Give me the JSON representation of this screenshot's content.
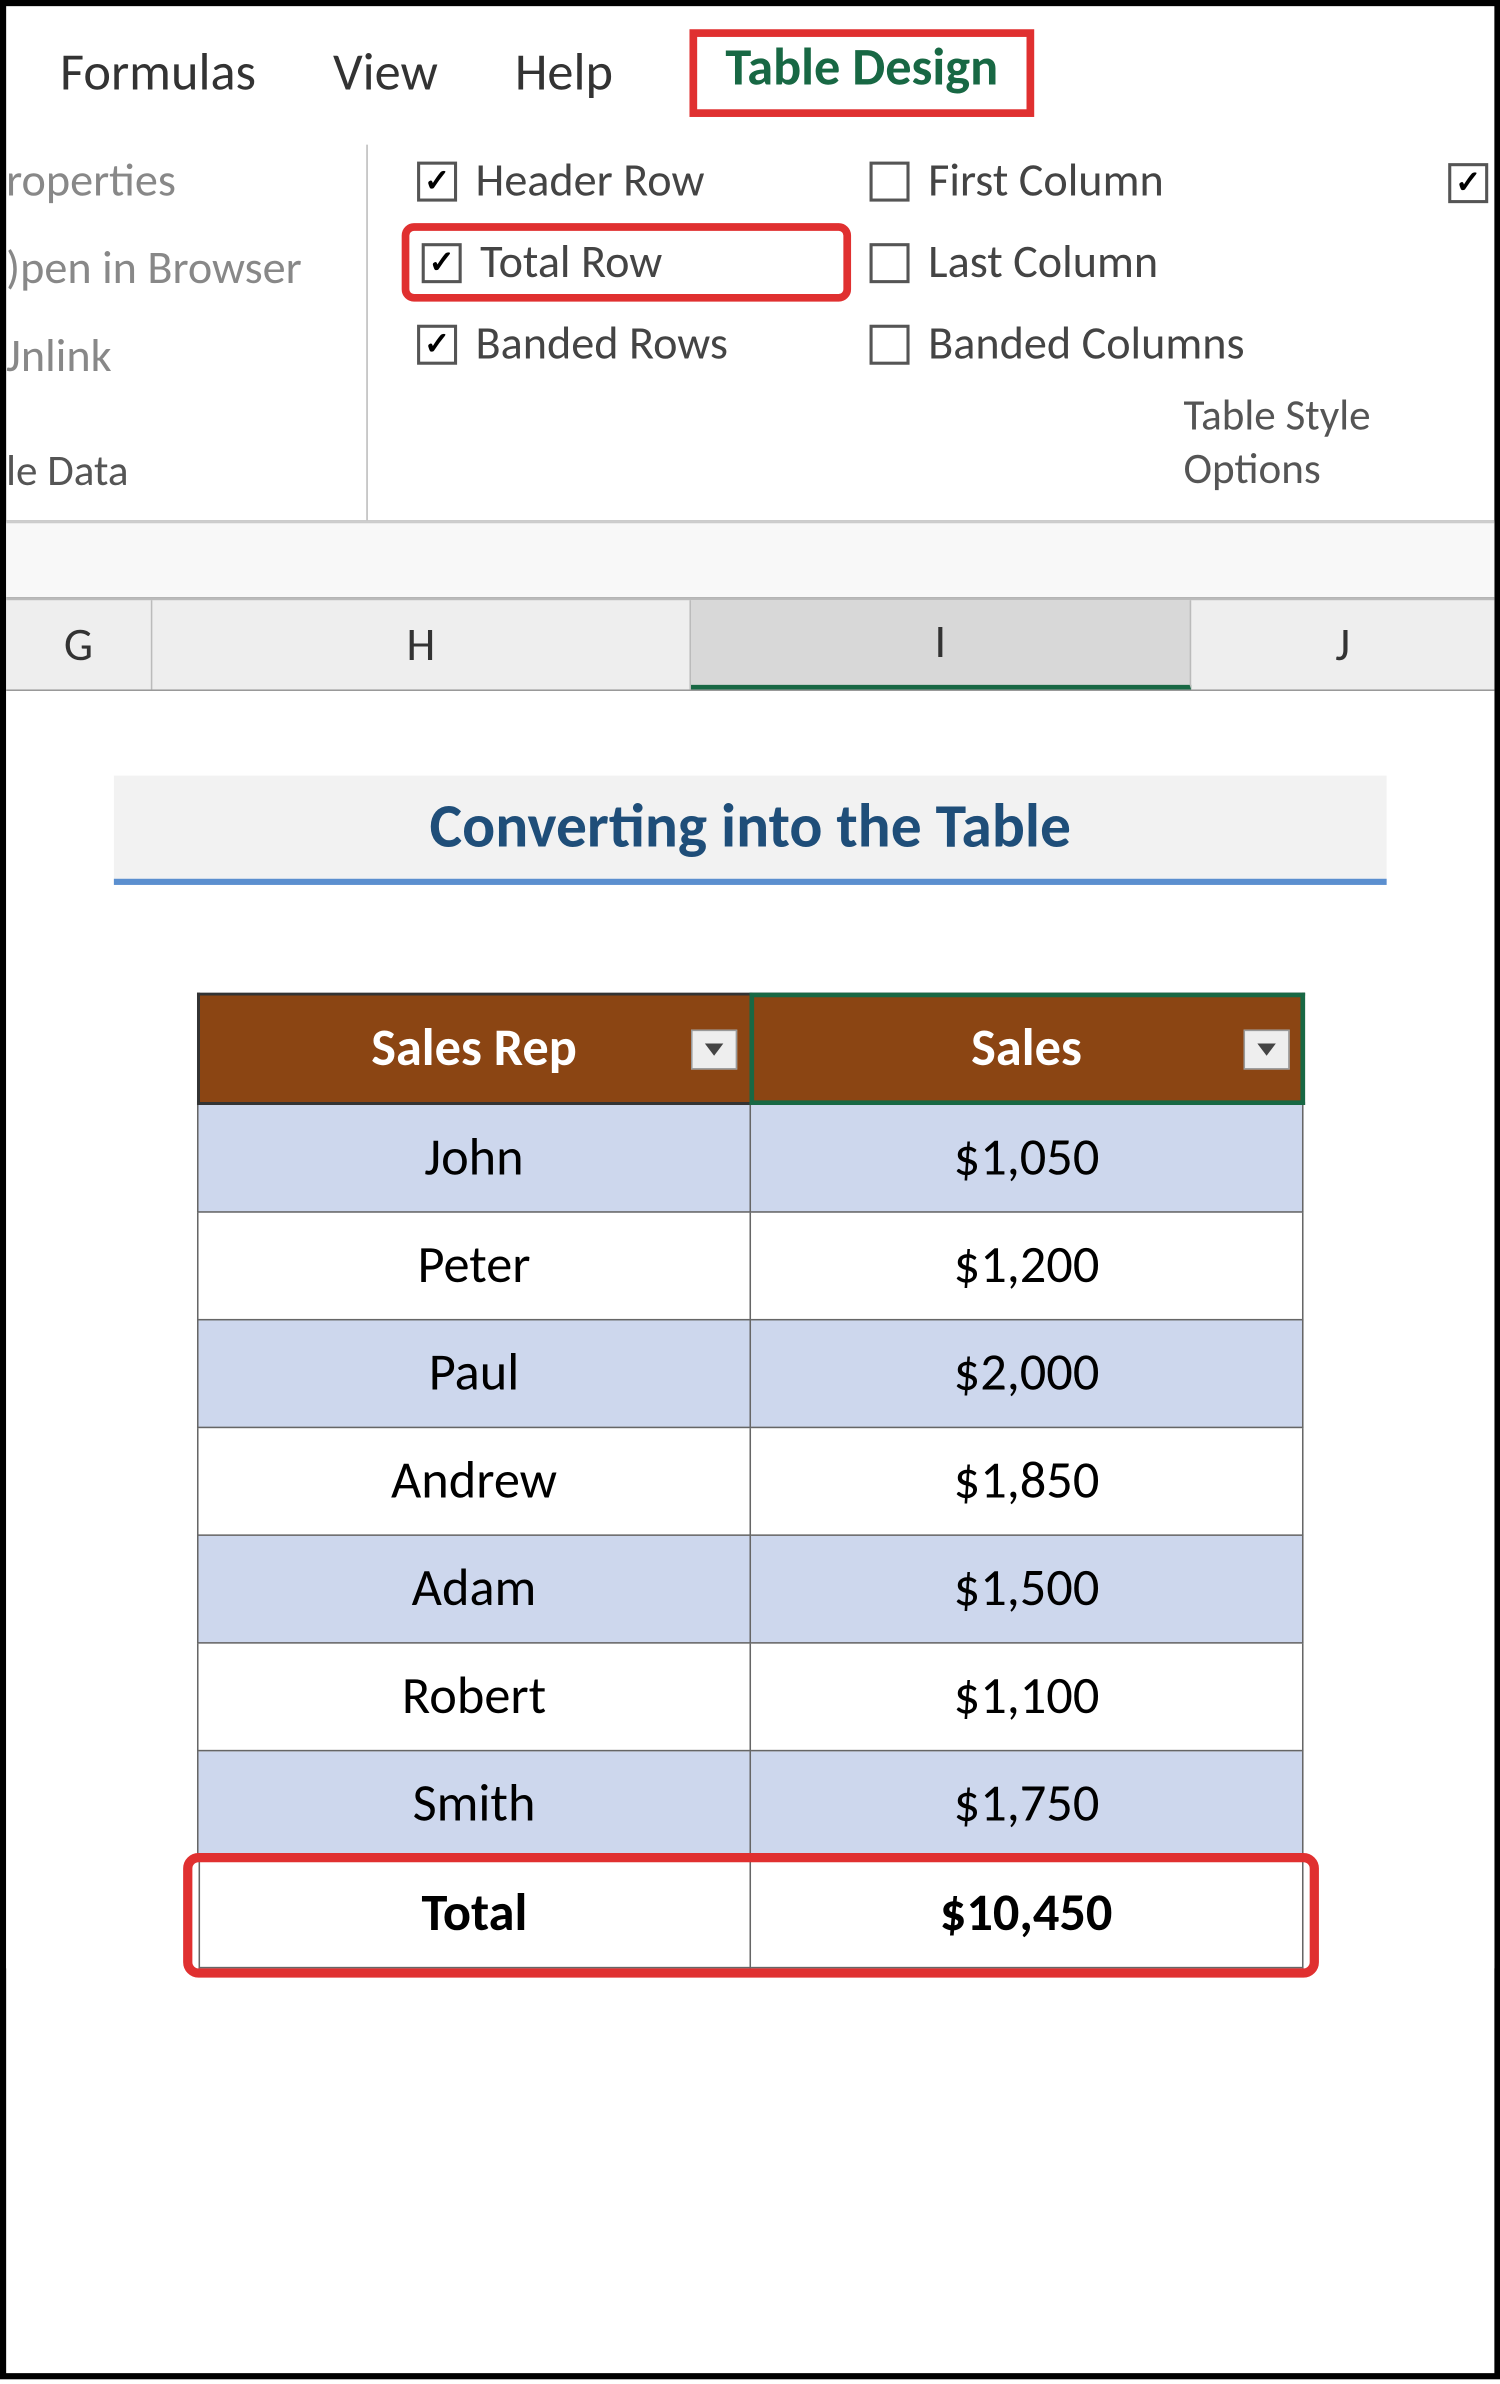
{
  "ribbon": {
    "tabs": {
      "formulas": "Formulas",
      "view": "View",
      "help": "Help",
      "table_design": "Table Design"
    },
    "left_items": {
      "properties": "roperties",
      "open_browser": ")pen in Browser",
      "unlink": "Jnlink",
      "group_label": "le Data"
    },
    "checkboxes": {
      "header_row": "Header Row",
      "total_row": "Total Row",
      "banded_rows": "Banded Rows",
      "first_column": "First Column",
      "last_column": "Last Column",
      "banded_columns": "Banded Columns"
    },
    "group_caption": "Table Style Options"
  },
  "columns": {
    "g": "G",
    "h": "H",
    "i": "I",
    "j": "J"
  },
  "sheet": {
    "title": "Converting into the Table",
    "headers": {
      "rep": "Sales Rep",
      "sales": "Sales"
    },
    "rows": [
      {
        "rep": "John",
        "sales": "$1,050"
      },
      {
        "rep": "Peter",
        "sales": "$1,200"
      },
      {
        "rep": "Paul",
        "sales": "$2,000"
      },
      {
        "rep": "Andrew",
        "sales": "$1,850"
      },
      {
        "rep": "Adam",
        "sales": "$1,500"
      },
      {
        "rep": "Robert",
        "sales": "$1,100"
      },
      {
        "rep": "Smith",
        "sales": "$1,750"
      }
    ],
    "total": {
      "label": "Total",
      "sales": "$10,450"
    }
  },
  "chart_data": {
    "type": "table",
    "title": "Converting into the Table",
    "columns": [
      "Sales Rep",
      "Sales"
    ],
    "rows": [
      [
        "John",
        1050
      ],
      [
        "Peter",
        1200
      ],
      [
        "Paul",
        2000
      ],
      [
        "Andrew",
        1850
      ],
      [
        "Adam",
        1500
      ],
      [
        "Robert",
        1100
      ],
      [
        "Smith",
        1750
      ]
    ],
    "total": [
      "Total",
      10450
    ]
  }
}
